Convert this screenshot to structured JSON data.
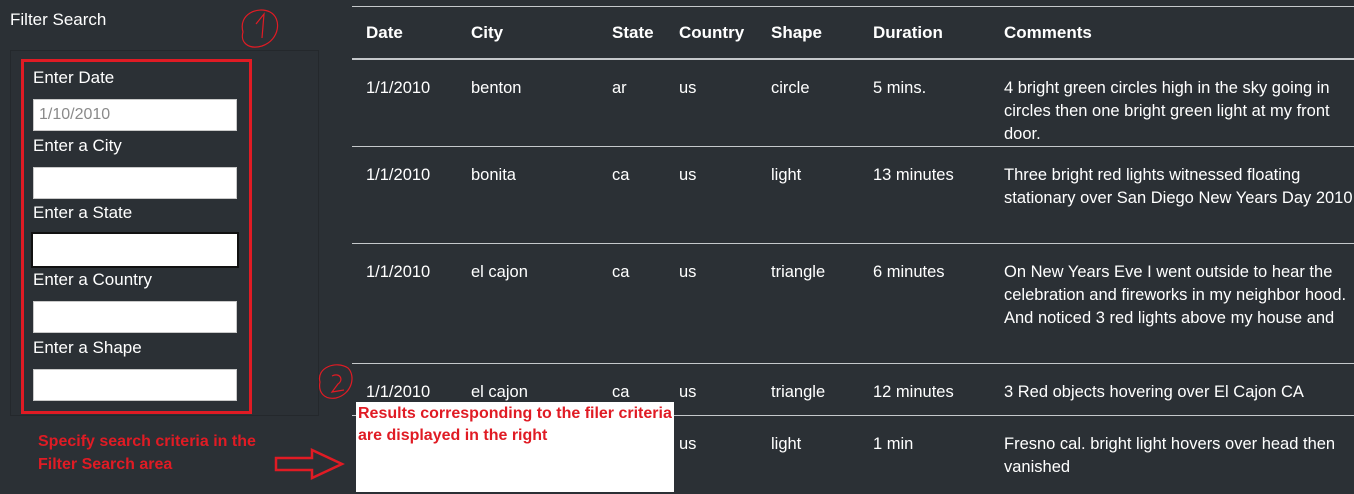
{
  "filter": {
    "title": "Filter Search",
    "fields": [
      {
        "label": "Enter Date",
        "placeholder": "1/10/2010",
        "value": ""
      },
      {
        "label": "Enter a City",
        "placeholder": "",
        "value": ""
      },
      {
        "label": "Enter a State",
        "placeholder": "",
        "value": ""
      },
      {
        "label": "Enter a Country",
        "placeholder": "",
        "value": ""
      },
      {
        "label": "Enter a Shape",
        "placeholder": "",
        "value": ""
      }
    ]
  },
  "table": {
    "headers": [
      "Date",
      "City",
      "State",
      "Country",
      "Shape",
      "Duration",
      "Comments"
    ],
    "rows": [
      [
        "1/1/2010",
        "benton",
        "ar",
        "us",
        "circle",
        "5 mins.",
        "4 bright green circles high in the sky going in circles then one bright green light at my front door."
      ],
      [
        "1/1/2010",
        "bonita",
        "ca",
        "us",
        "light",
        "13 minutes",
        "Three bright red lights witnessed floating stationary over San Diego New Years Day 2010"
      ],
      [
        "1/1/2010",
        "el cajon",
        "ca",
        "us",
        "triangle",
        "6 minutes",
        "On New Years Eve I went outside to hear the celebration and fireworks in my neighbor hood. And noticed 3 red lights above my house and"
      ],
      [
        "1/1/2010",
        "el cajon",
        "ca",
        "us",
        "triangle",
        "12 minutes",
        "3 Red objects hovering over El Cajon CA"
      ],
      [
        "",
        "",
        "",
        "us",
        "light",
        "1 min",
        "Fresno cal. bright light hovers over head then vanished"
      ]
    ]
  },
  "annotations": {
    "left_note": "Specify search criteria in the Filter Search area",
    "callout": "Results corresponding to the filer criteria are displayed in the right",
    "marker_1": "1",
    "marker_2": "2",
    "color": "#e01b24"
  }
}
